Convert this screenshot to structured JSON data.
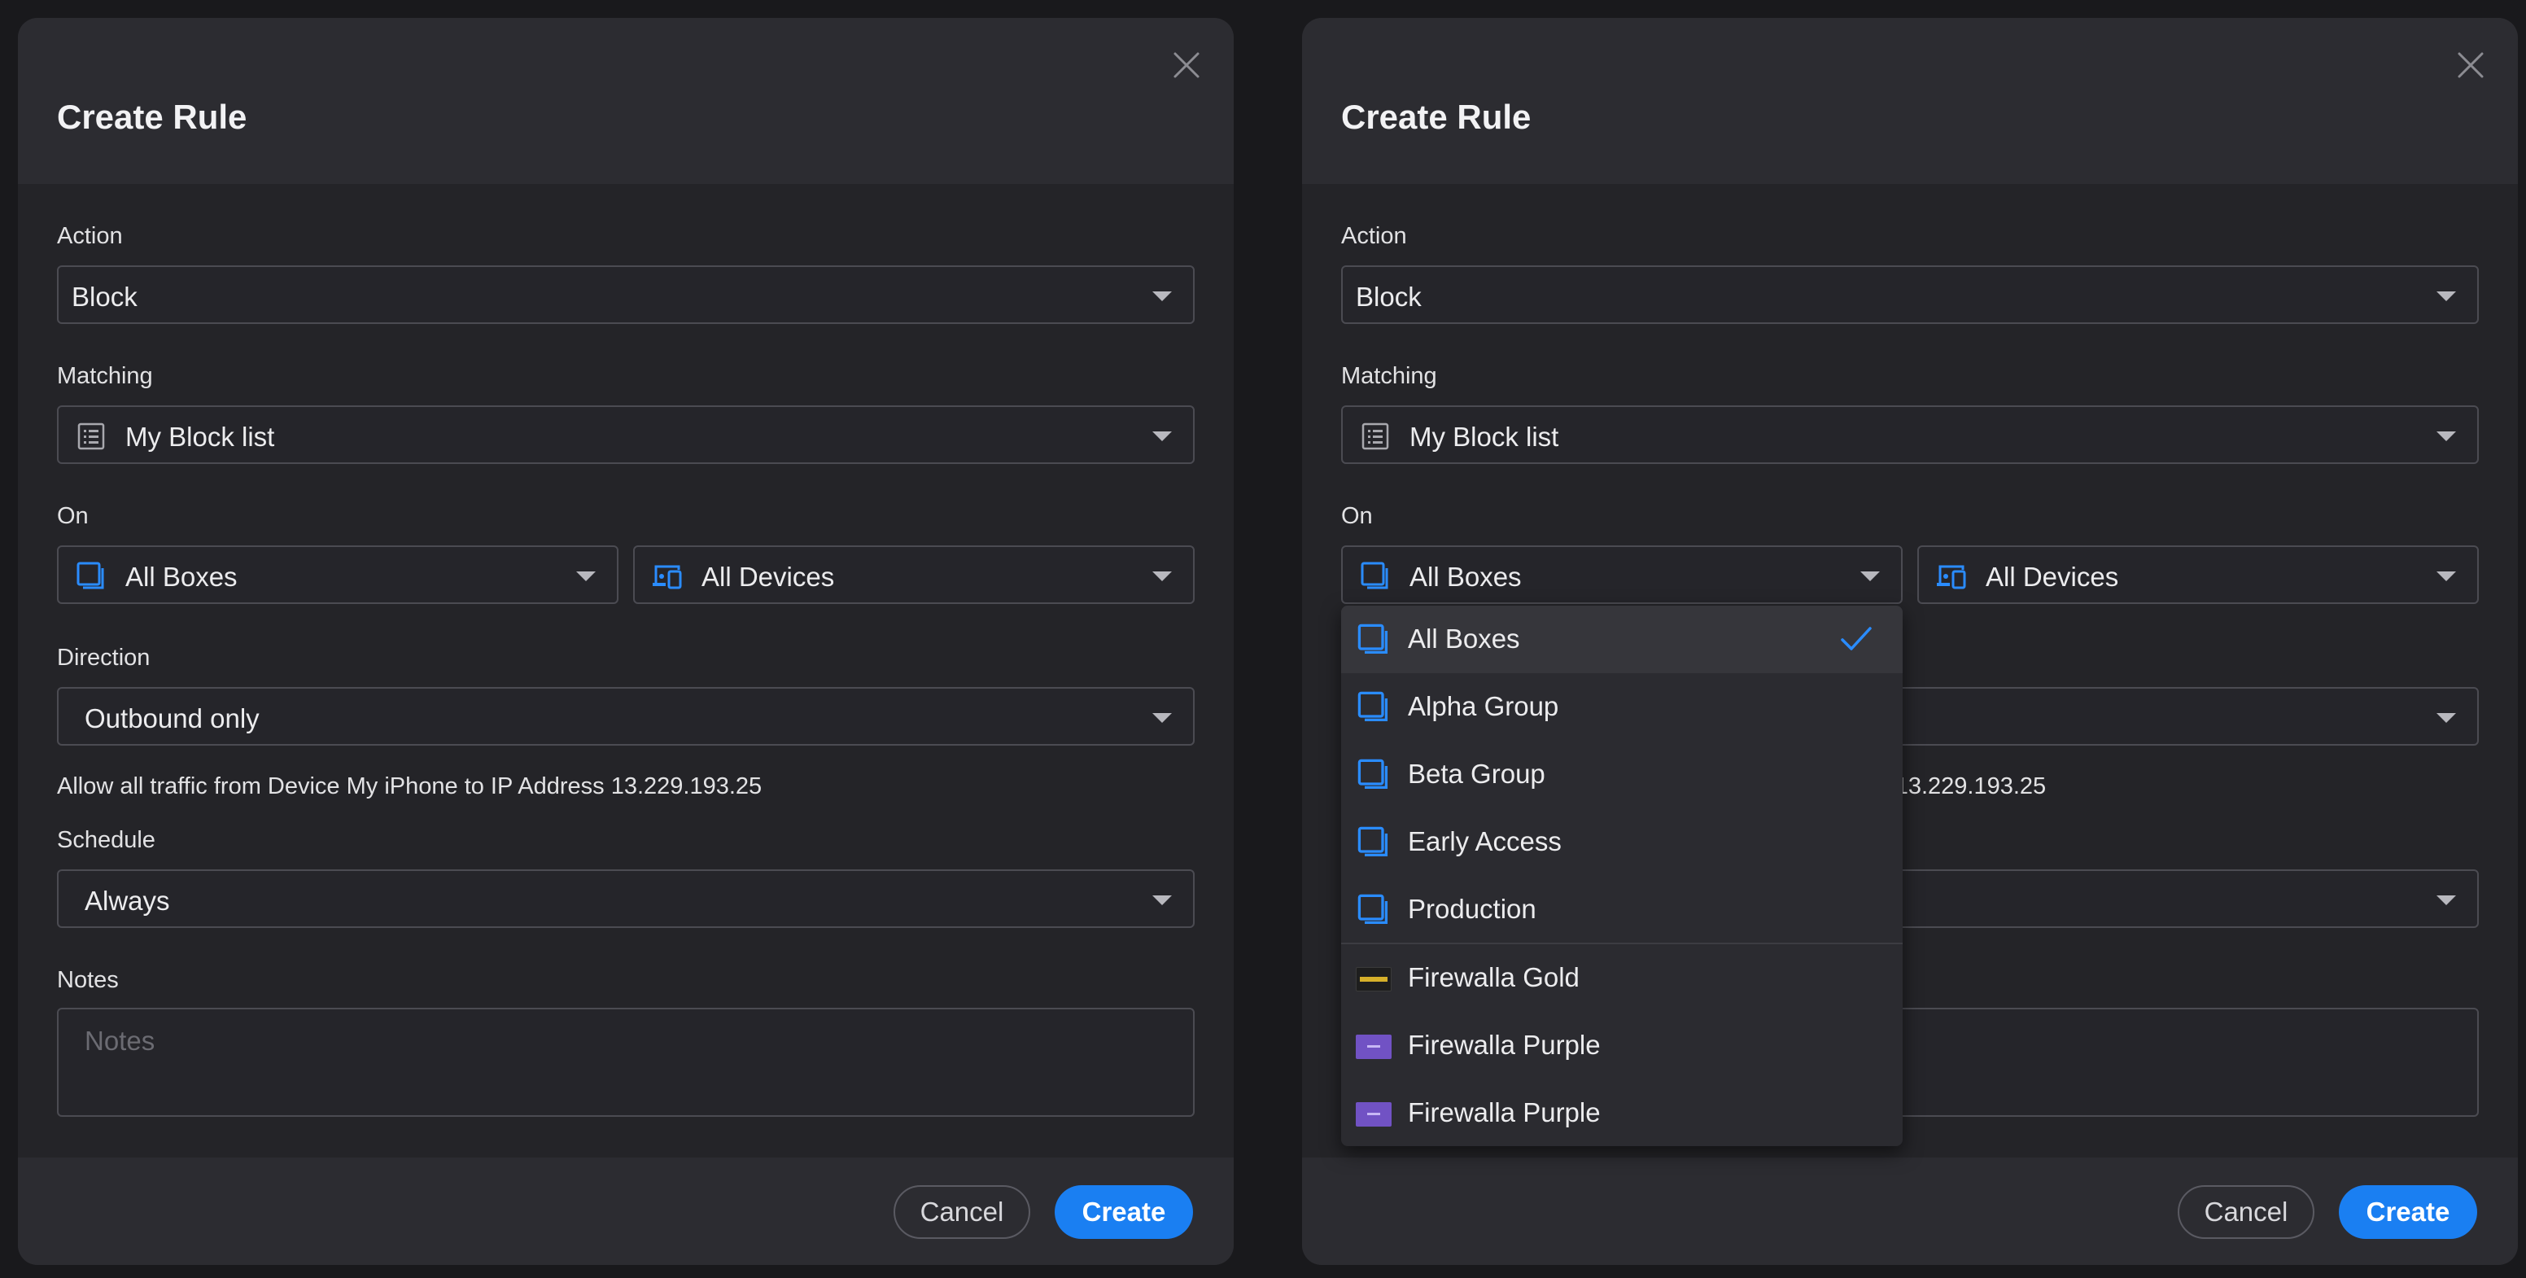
{
  "colors": {
    "accent": "#1a7ff2",
    "background": "#19191c",
    "dialog": "#242428",
    "header": "#2c2c31"
  },
  "dialog": {
    "title": "Create Rule",
    "close_icon": "close-icon",
    "action": {
      "label": "Action",
      "value": "Block"
    },
    "matching": {
      "label": "Matching",
      "value": "My Block list",
      "icon": "list-icon"
    },
    "on": {
      "label": "On",
      "boxes_value": "All Boxes",
      "boxes_icon": "boxes-icon",
      "devices_value": "All Devices",
      "devices_icon": "devices-icon"
    },
    "direction": {
      "label": "Direction",
      "value": "Outbound only"
    },
    "info": "Allow all traffic from Device My iPhone to IP Address 13.229.193.25",
    "schedule": {
      "label": "Schedule",
      "value": "Always"
    },
    "notes": {
      "label": "Notes",
      "placeholder": "Notes"
    },
    "cancel_label": "Cancel",
    "create_label": "Create"
  },
  "boxes_menu": {
    "items": [
      {
        "label": "All Boxes",
        "icon": "boxes-icon",
        "selected": true
      },
      {
        "label": "Alpha Group",
        "icon": "boxes-icon"
      },
      {
        "label": "Beta Group",
        "icon": "boxes-icon"
      },
      {
        "label": "Early Access",
        "icon": "boxes-icon"
      },
      {
        "label": "Production",
        "icon": "boxes-icon"
      },
      {
        "label": "Firewalla Gold",
        "icon": "firewalla-gold-box-icon"
      },
      {
        "label": "Firewalla Purple",
        "icon": "firewalla-purple-box-icon"
      },
      {
        "label": "Firewalla Purple",
        "icon": "firewalla-purple-box-icon"
      }
    ]
  }
}
